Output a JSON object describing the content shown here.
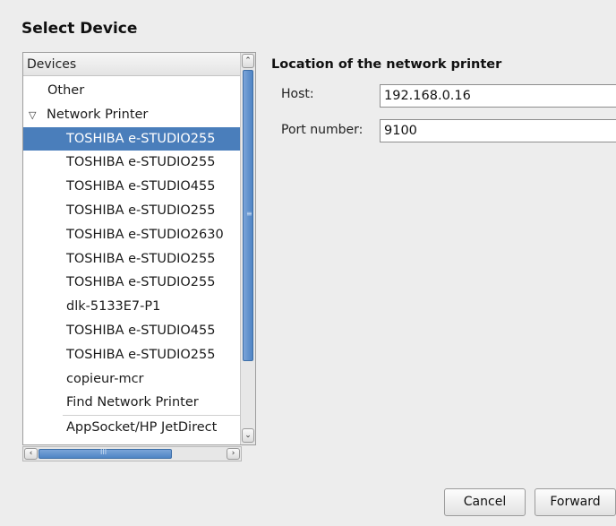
{
  "dialog": {
    "title": "Select Device"
  },
  "devices": {
    "header": "Devices",
    "items": [
      {
        "label": "Other",
        "level": "top"
      },
      {
        "label": "Network Printer",
        "level": "group",
        "expander": "▽"
      },
      {
        "label": "TOSHIBA e-STUDIO255",
        "level": "child",
        "selected": true
      },
      {
        "label": "TOSHIBA e-STUDIO255",
        "level": "child"
      },
      {
        "label": "TOSHIBA e-STUDIO455",
        "level": "child"
      },
      {
        "label": "TOSHIBA e-STUDIO255",
        "level": "child"
      },
      {
        "label": "TOSHIBA e-STUDIO2630",
        "level": "child"
      },
      {
        "label": "TOSHIBA e-STUDIO255",
        "level": "child"
      },
      {
        "label": "TOSHIBA e-STUDIO255",
        "level": "child"
      },
      {
        "label": "dlk-5133E7-P1",
        "level": "child"
      },
      {
        "label": "TOSHIBA e-STUDIO455",
        "level": "child"
      },
      {
        "label": "TOSHIBA e-STUDIO255",
        "level": "child"
      },
      {
        "label": "copieur-mcr",
        "level": "child"
      },
      {
        "label": "Find Network Printer",
        "level": "child"
      },
      {
        "label": "AppSocket/HP JetDirect",
        "level": "child"
      }
    ],
    "scroll": {
      "up": "⌃",
      "down": "⌄",
      "left": "‹",
      "right": "›",
      "grip_v": "≡",
      "grip_h": "III"
    }
  },
  "location": {
    "title": "Location of the network printer",
    "host_label": "Host:",
    "host_value": "192.168.0.16",
    "port_label": "Port number:",
    "port_value": "9100"
  },
  "buttons": {
    "cancel": "Cancel",
    "forward": "Forward"
  },
  "colors": {
    "selection": "#4a7ebb",
    "scrollbar_thumb": "#4f84c4"
  }
}
